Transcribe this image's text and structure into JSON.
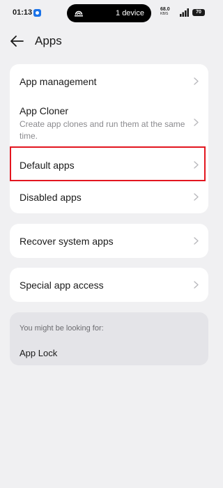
{
  "status_bar": {
    "time": "01:13",
    "device_pill_text": "1 device",
    "net_speed_value": "68.0",
    "net_speed_unit": "KB/S",
    "battery": "70"
  },
  "header": {
    "title": "Apps"
  },
  "settings": {
    "group1": [
      {
        "title": "App management",
        "subtitle": ""
      },
      {
        "title": "App Cloner",
        "subtitle": "Create app clones and run them at the same time."
      },
      {
        "title": "Default apps",
        "subtitle": ""
      },
      {
        "title": "Disabled apps",
        "subtitle": ""
      }
    ],
    "group2": [
      {
        "title": "Recover system apps"
      }
    ],
    "group3": [
      {
        "title": "Special app access"
      }
    ]
  },
  "suggestions": {
    "label": "You might be looking for:",
    "items": [
      "App Lock"
    ]
  },
  "colors": {
    "highlight": "#e3161f",
    "background": "#f0f0f2"
  }
}
